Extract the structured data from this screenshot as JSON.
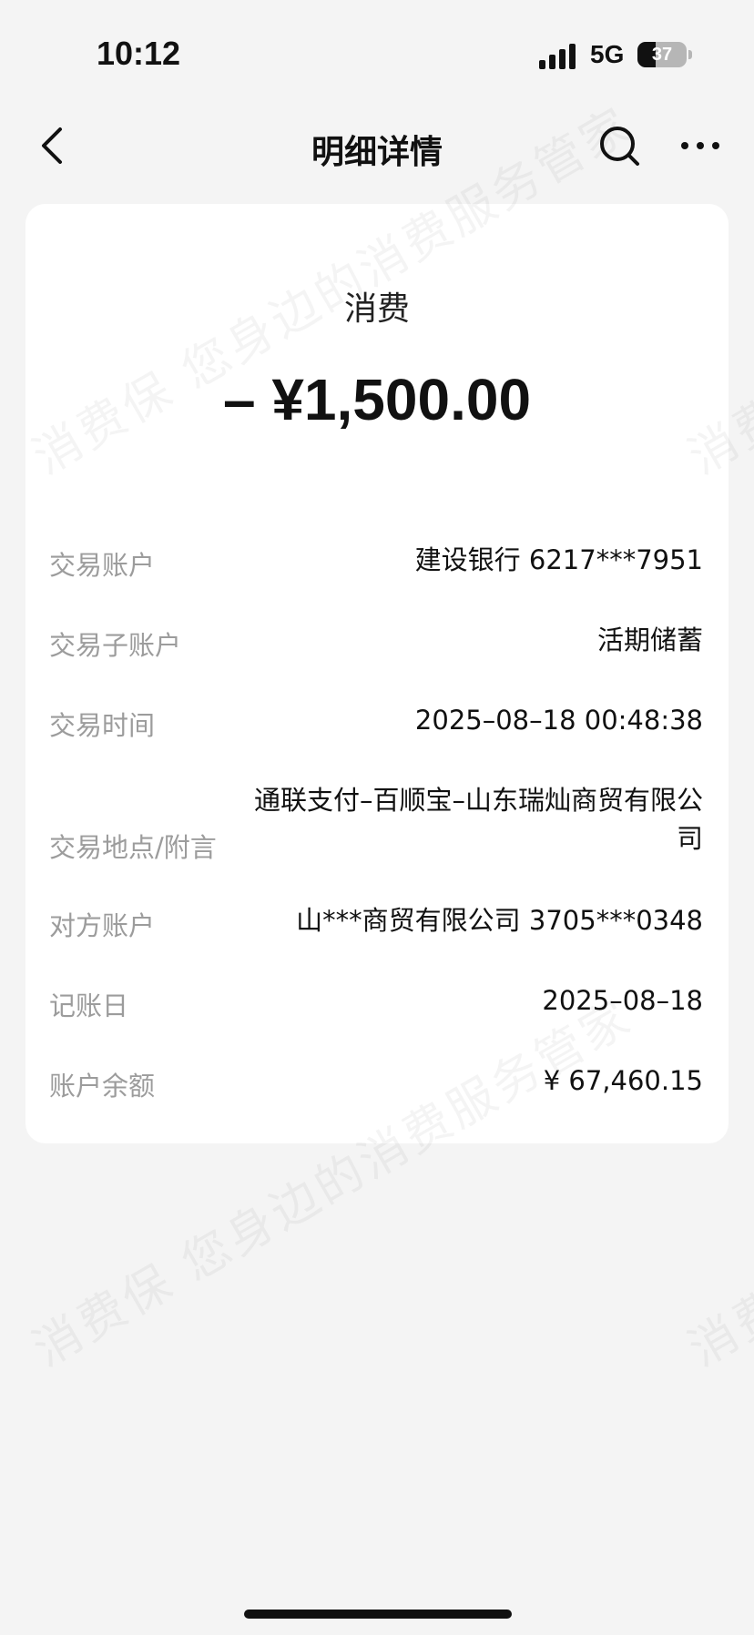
{
  "status_bar": {
    "time": "10:12",
    "network": "5G",
    "battery_percent": "37",
    "battery_level": 0.37
  },
  "nav": {
    "title": "明细详情",
    "back_icon": "chevron-left-icon",
    "search_icon": "search-icon",
    "more_icon": "more-horizontal-icon"
  },
  "transaction": {
    "type": "消费",
    "amount": "– ¥1,500.00",
    "details": [
      {
        "label": "交易账户",
        "value": "建设银行 6217***7951"
      },
      {
        "label": "交易子账户",
        "value": "活期储蓄"
      },
      {
        "label": "交易时间",
        "value": "2025–08–18 00:48:38"
      },
      {
        "label": "交易地点/附言",
        "value": "通联支付–百顺宝–山东瑞灿商贸有限公司"
      },
      {
        "label": "对方账户",
        "value": "山***商贸有限公司 3705***0348"
      },
      {
        "label": "记账日",
        "value": "2025–08–18"
      },
      {
        "label": "账户余额",
        "value": "¥ 67,460.15"
      }
    ]
  },
  "watermark": {
    "text": "消费保 您身边的消费服务管家"
  }
}
